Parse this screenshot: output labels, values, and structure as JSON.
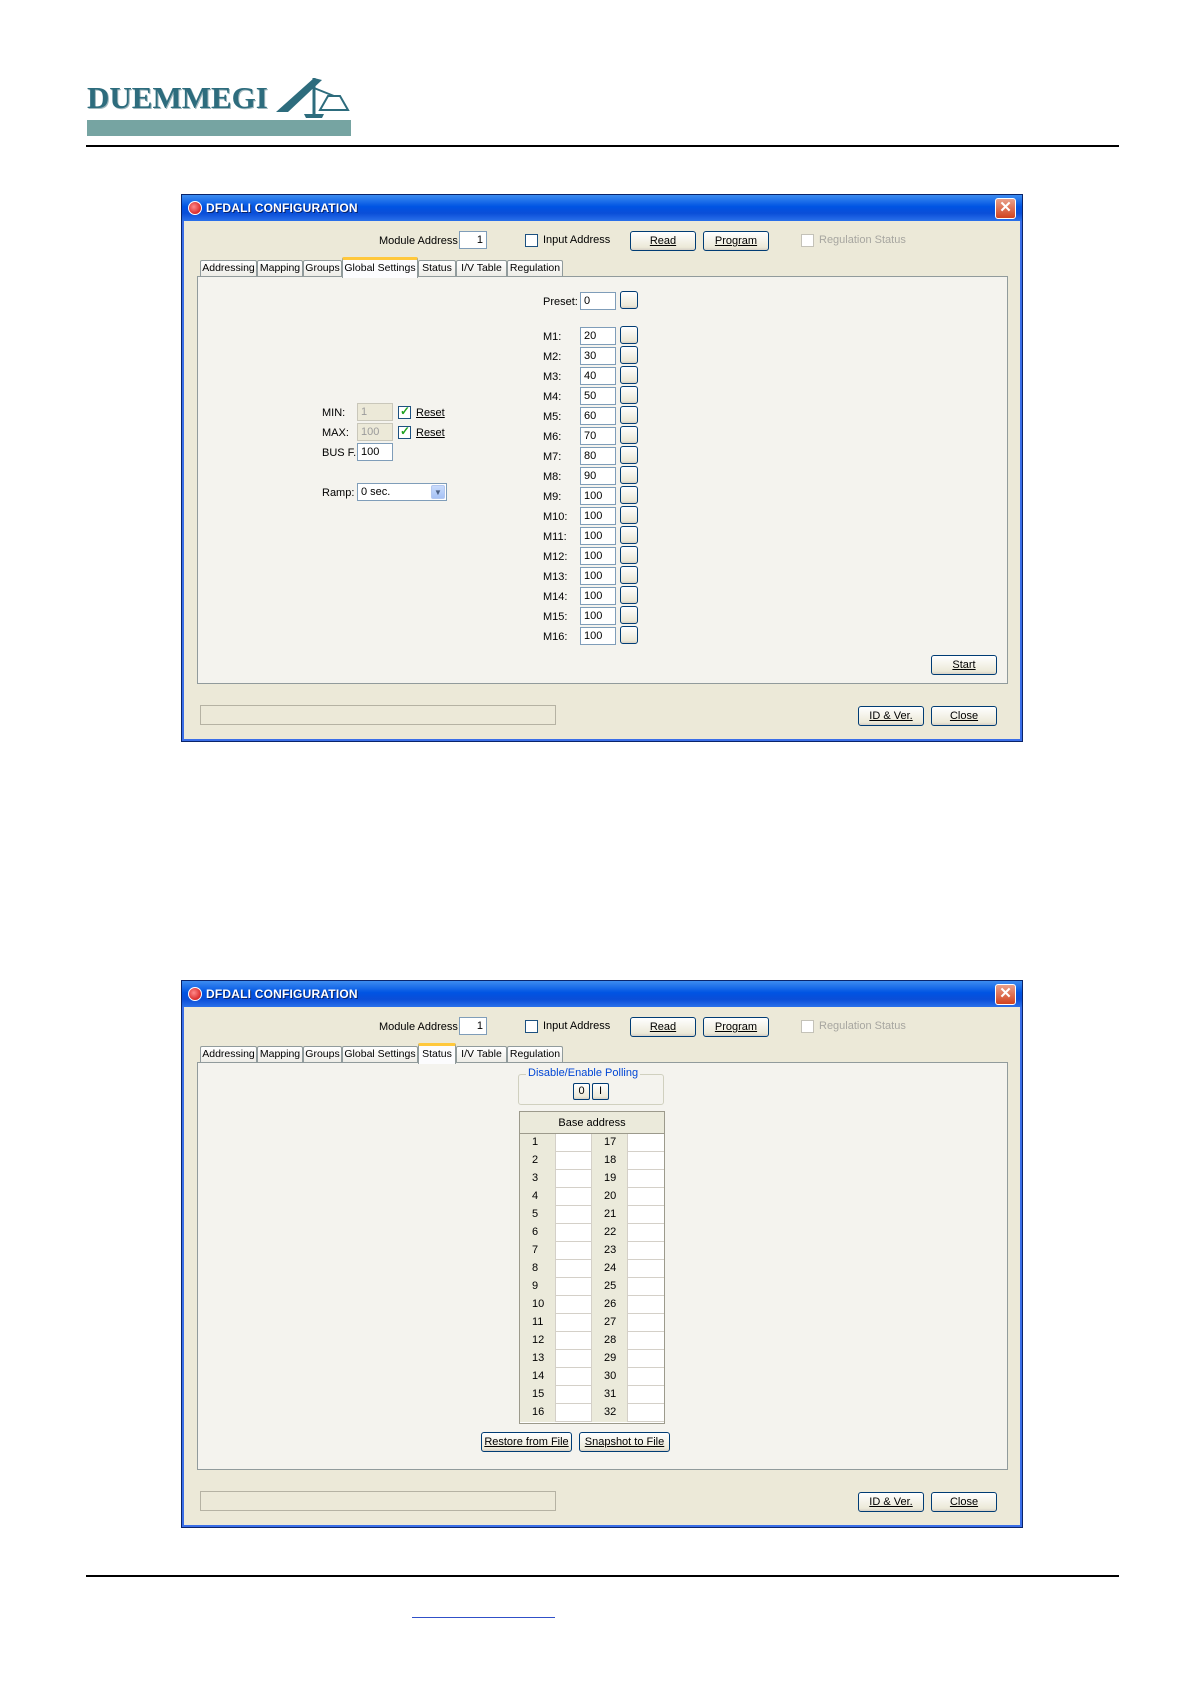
{
  "logo": {
    "text": "DUEMMEGI"
  },
  "common": {
    "title": "DFDALI CONFIGURATION",
    "close_glyph": "✕",
    "module_address_label": "Module Address",
    "module_address_value": "1",
    "input_address_label": "Input Address",
    "read_label": "Read",
    "program_label": "Program",
    "regulation_status_label": "Regulation Status",
    "tabs": [
      "Addressing",
      "Mapping",
      "Groups",
      "Global Settings",
      "Status",
      "I/V Table",
      "Regulation"
    ],
    "id_ver_label": "ID & Ver.",
    "close_label": "Close"
  },
  "window1": {
    "active_tab": "Global Settings",
    "preset_label": "Preset:",
    "preset_value": "0",
    "memories": [
      {
        "label": "M1:",
        "value": "20"
      },
      {
        "label": "M2:",
        "value": "30"
      },
      {
        "label": "M3:",
        "value": "40"
      },
      {
        "label": "M4:",
        "value": "50"
      },
      {
        "label": "M5:",
        "value": "60"
      },
      {
        "label": "M6:",
        "value": "70"
      },
      {
        "label": "M7:",
        "value": "80"
      },
      {
        "label": "M8:",
        "value": "90"
      },
      {
        "label": "M9:",
        "value": "100"
      },
      {
        "label": "M10:",
        "value": "100"
      },
      {
        "label": "M11:",
        "value": "100"
      },
      {
        "label": "M12:",
        "value": "100"
      },
      {
        "label": "M13:",
        "value": "100"
      },
      {
        "label": "M14:",
        "value": "100"
      },
      {
        "label": "M15:",
        "value": "100"
      },
      {
        "label": "M16:",
        "value": "100"
      }
    ],
    "min_label": "MIN:",
    "min_value": "1",
    "max_label": "MAX:",
    "max_value": "100",
    "reset_label": "Reset",
    "busf_label": "BUS F.:",
    "busf_value": "100",
    "ramp_label": "Ramp:",
    "ramp_value": "0 sec.",
    "start_label": "Start"
  },
  "window2": {
    "active_tab": "Status",
    "polling_title": "Disable/Enable Polling",
    "polling_off": "0",
    "polling_on": "I",
    "table_header": "Base address",
    "left_addresses": [
      "1",
      "2",
      "3",
      "4",
      "5",
      "6",
      "7",
      "8",
      "9",
      "10",
      "11",
      "12",
      "13",
      "14",
      "15",
      "16"
    ],
    "right_addresses": [
      "17",
      "18",
      "19",
      "20",
      "21",
      "22",
      "23",
      "24",
      "25",
      "26",
      "27",
      "28",
      "29",
      "30",
      "31",
      "32"
    ],
    "restore_label": "Restore from File",
    "snapshot_label": "Snapshot to File"
  }
}
